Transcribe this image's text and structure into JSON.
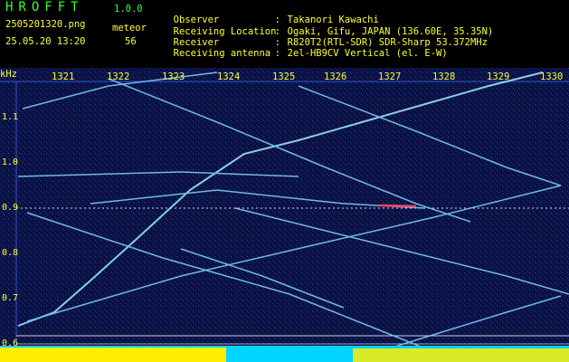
{
  "header": {
    "app_title": "HROFFT",
    "app_version": "1.0.0",
    "file_name": "2505201320.png",
    "datetime": "25.05.20 13:20",
    "meteor_label": "meteor",
    "meteor_count": "56"
  },
  "info": [
    {
      "key": "Observer",
      "value": "Takanori Kawachi"
    },
    {
      "key": "Receiving Location",
      "value": "Ogaki, Gifu, JAPAN (136.60E, 35.35N)"
    },
    {
      "key": "Receiver",
      "value": "R820T2(RTL-SDR) SDR-Sharp 53.372MHz"
    },
    {
      "key": "Receiving antenna",
      "value": "2el-HB9CV Vertical (el. E-W)"
    }
  ],
  "axis": {
    "unit": "kHz",
    "time_ticks": [
      "1321",
      "1322",
      "1323",
      "1324",
      "1325",
      "1326",
      "1327",
      "1328",
      "1329",
      "1330"
    ],
    "freq_ticks": [
      "1.1",
      "1.0",
      "0.9",
      "0.8",
      "0.7",
      "0.6"
    ]
  },
  "colors": {
    "background": "#000000",
    "text_primary": "#ffff33",
    "title": "#33ff33",
    "spectrogram_bg": "#0a1040",
    "trace": "#7fd8ff",
    "level_bar": "#ffee00"
  }
}
